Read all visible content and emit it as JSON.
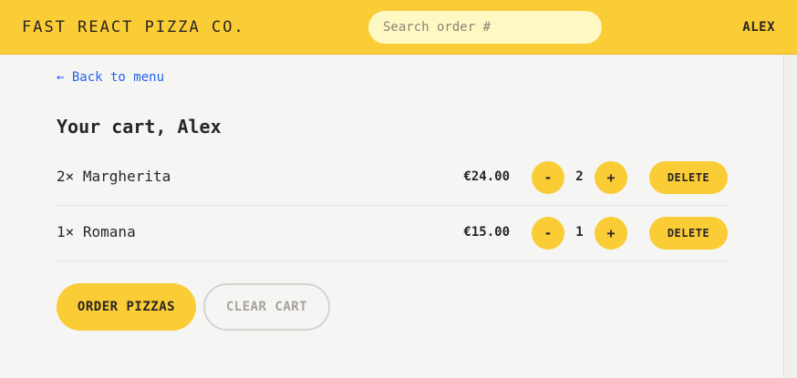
{
  "header": {
    "logo": "FAST REACT PIZZA CO.",
    "search_placeholder": "Search order #",
    "search_value": "",
    "username": "ALEX"
  },
  "nav": {
    "back_link": "← Back to menu"
  },
  "cart": {
    "title": "Your cart, Alex",
    "items": [
      {
        "name": "2× Margherita",
        "price": "€24.00",
        "quantity": "2",
        "decrease": "-",
        "increase": "+",
        "delete_label": "DELETE"
      },
      {
        "name": "1× Romana",
        "price": "€15.00",
        "quantity": "1",
        "decrease": "-",
        "increase": "+",
        "delete_label": "DELETE"
      }
    ],
    "order_button": "ORDER PIZZAS",
    "clear_button": "CLEAR CART"
  },
  "colors": {
    "accent": "#facc36",
    "background": "#f5f5f4",
    "link": "#2563eb",
    "search_bg": "#fef9c3"
  }
}
